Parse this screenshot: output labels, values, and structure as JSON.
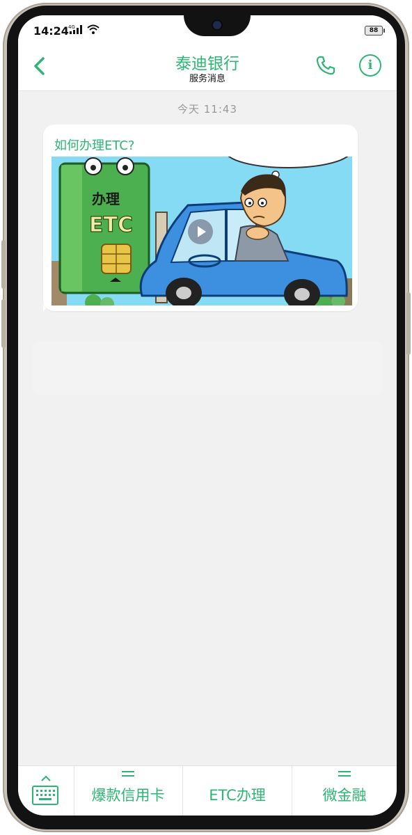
{
  "status_bar": {
    "time": "14:24",
    "network": "4G",
    "battery": "88"
  },
  "header": {
    "title": "泰迪银行",
    "subtitle": "服务消息",
    "back_icon": "chevron-left-icon",
    "call_icon": "phone-icon",
    "info_icon": "info-icon",
    "info_glyph": "i"
  },
  "conversation": {
    "timestamp": "今天  11:43",
    "message": {
      "title": "如何办理ETC?",
      "media_type": "video",
      "illustration_text": {
        "card_line1": "办理",
        "card_line2": "ETC"
      }
    }
  },
  "bottom_menu": {
    "keyboard_icon": "keyboard-icon",
    "items": [
      {
        "label": "爆款信用卡",
        "has_submenu": true
      },
      {
        "label": "ETC办理",
        "has_submenu": false
      },
      {
        "label": "微金融",
        "has_submenu": true
      }
    ]
  },
  "colors": {
    "accent": "#2bb673",
    "background": "#f1f1f1",
    "header": "#ffffff"
  }
}
